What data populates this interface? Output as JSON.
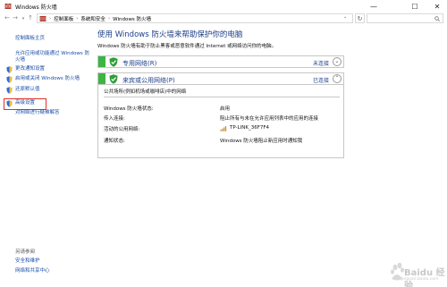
{
  "window": {
    "title": "Windows 防火墙"
  },
  "titlebar_buttons": {
    "minimize": "—",
    "maximize": "☐",
    "close": "✕"
  },
  "address": {
    "crumbs": [
      "控制面板",
      "系统和安全",
      "Windows 防火墙"
    ],
    "separator": "›"
  },
  "sidebar": {
    "items": [
      {
        "label": "控制面板主页",
        "icon": null
      },
      {
        "label": "允许应用或功能通过 Windows 防火墙",
        "icon": null
      },
      {
        "label": "更改通知设置",
        "icon": "shield-icon"
      },
      {
        "label": "启用或关闭 Windows 防火墙",
        "icon": "shield-icon"
      },
      {
        "label": "还原默认值",
        "icon": "shield-icon"
      },
      {
        "label": "高级设置",
        "icon": "shield-icon",
        "highlighted": true
      },
      {
        "label": "对网络进行疑难解答",
        "icon": null
      }
    ],
    "see_also": {
      "title": "另请参阅",
      "links": [
        "安全和维护",
        "网络和共享中心"
      ]
    }
  },
  "main": {
    "heading": "使用 Windows 防火墙来帮助保护你的电脑",
    "description": "Windows 防火墙有助于防止黑客或恶意软件通过 Internet 或网络访问你的电脑。",
    "networks": [
      {
        "name": "专用网络(R)",
        "status": "未连接",
        "expanded": false,
        "chevron": "⌄"
      },
      {
        "name": "来宾或公用网络(P)",
        "status": "已连接",
        "expanded": true,
        "chevron": "⌃"
      }
    ],
    "public_details": {
      "description": "公共场所(例如机场或咖啡店)中的网络",
      "rows": [
        {
          "label": "Windows 防火墙状态:",
          "value": "启用"
        },
        {
          "label": "传入连接:",
          "value": "阻止所有与未在允许应用列表中的应用的连接"
        },
        {
          "label": "活动的公用网络:",
          "value": "TP-LINK_36F7F4"
        },
        {
          "label": "通知状态:",
          "value": "Windows 防火墙阻止新应用时通知我"
        }
      ]
    }
  },
  "watermark": {
    "text": "Baidu 经验",
    "sub": "jingyan.baidu.com"
  },
  "colors": {
    "accent": "#1d3f8a",
    "link": "#1a4ea8",
    "green": "#3db544",
    "highlight": "#e0312a"
  }
}
